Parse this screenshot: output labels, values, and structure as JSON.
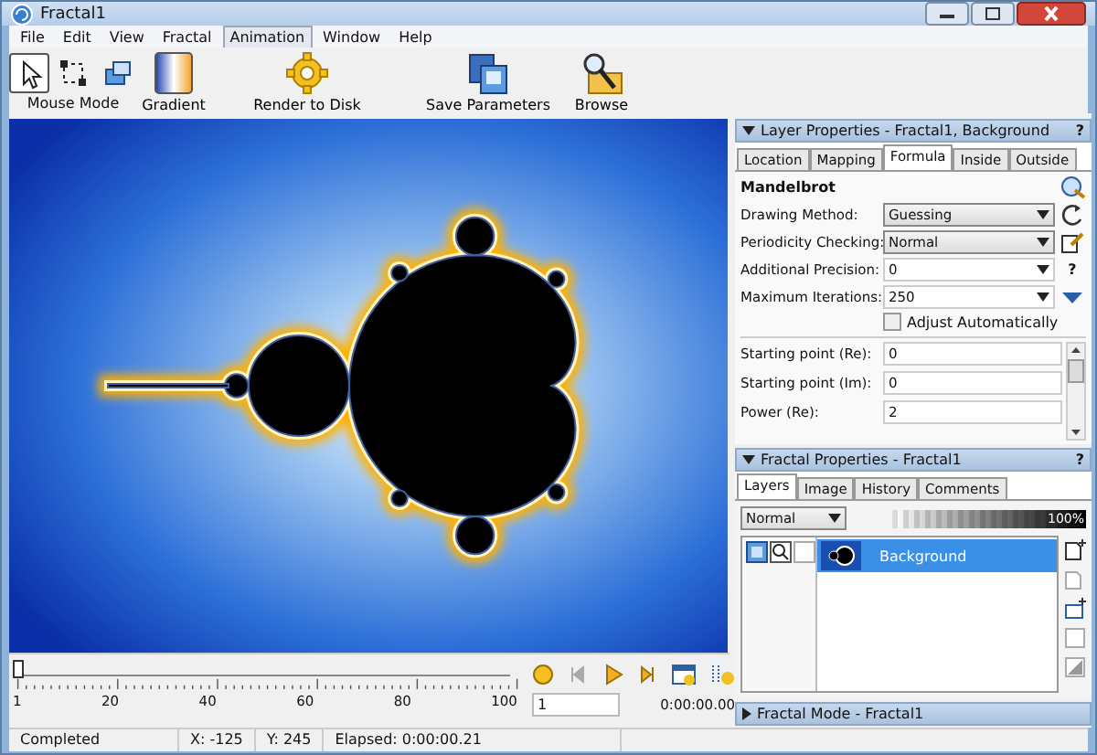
{
  "window": {
    "title": "Fractal1"
  },
  "menu": [
    {
      "label": "File",
      "selected": false
    },
    {
      "label": "Edit",
      "selected": false
    },
    {
      "label": "View",
      "selected": false
    },
    {
      "label": "Fractal",
      "selected": false
    },
    {
      "label": "Animation",
      "selected": true
    },
    {
      "label": "Window",
      "selected": false
    },
    {
      "label": "Help",
      "selected": false
    }
  ],
  "toolbar": {
    "mouse_mode": {
      "label": "Mouse Mode",
      "tools": [
        {
          "kind": "pointer",
          "selected": true
        },
        {
          "kind": "select",
          "selected": false
        },
        {
          "kind": "windows",
          "selected": false
        }
      ]
    },
    "buttons": [
      {
        "kind": "gradient",
        "label": "Gradient"
      },
      {
        "kind": "gear",
        "label": "Render to Disk"
      },
      {
        "kind": "save",
        "label": "Save Parameters"
      },
      {
        "kind": "browse",
        "label": "Browse"
      }
    ]
  },
  "layer_panel": {
    "title": "Layer Properties - Fractal1, Background",
    "help": "?",
    "expanded": true,
    "tabs": [
      {
        "label": "Location",
        "selected": false
      },
      {
        "label": "Mapping",
        "selected": false
      },
      {
        "label": "Formula",
        "selected": true
      },
      {
        "label": "Inside",
        "selected": false
      },
      {
        "label": "Outside",
        "selected": false
      }
    ],
    "formula_name": "Mandelbrot",
    "fields": [
      {
        "label": "Drawing Method:",
        "value": "Guessing",
        "kind": "select",
        "action": {
          "kind": "refresh"
        }
      },
      {
        "label": "Periodicity Checking:",
        "value": "Normal",
        "kind": "select",
        "action": {
          "kind": "edit"
        }
      },
      {
        "label": "Additional Precision:",
        "value": "0",
        "kind": "combo",
        "action": {
          "kind": "help",
          "text": "?"
        }
      },
      {
        "label": "Maximum Iterations:",
        "value": "250",
        "kind": "combo",
        "action": {
          "kind": "expand"
        }
      }
    ],
    "adjust": {
      "label": "Adjust Automatically",
      "checked": false
    },
    "params": [
      {
        "label": "Starting point (Re):",
        "value": "0"
      },
      {
        "label": "Starting point (Im):",
        "value": "0"
      },
      {
        "label": "Power (Re):",
        "value": "2"
      }
    ]
  },
  "fractal_panel": {
    "title": "Fractal Properties - Fractal1",
    "help": "?",
    "expanded": true,
    "tabs": [
      {
        "label": "Layers",
        "selected": true
      },
      {
        "label": "Image",
        "selected": false
      },
      {
        "label": "History",
        "selected": false
      },
      {
        "label": "Comments",
        "selected": false
      }
    ],
    "blend_mode": "Normal",
    "opacity": {
      "level": 1,
      "reading": "100%"
    },
    "layers": [
      {
        "name": "Background",
        "selected": true,
        "visible": true,
        "checked": false
      }
    ]
  },
  "mode_panel": {
    "title": "Fractal Mode - Fractal1",
    "expanded": false
  },
  "timeline": {
    "level": 0,
    "tick_labels": [
      "1",
      "20",
      "40",
      "60",
      "80",
      "100"
    ],
    "frame": "1",
    "time": "0:00:00.00"
  },
  "status_bar": [
    "Completed",
    "X: -125",
    "Y: 245",
    "Elapsed: 0:00:00.21"
  ]
}
